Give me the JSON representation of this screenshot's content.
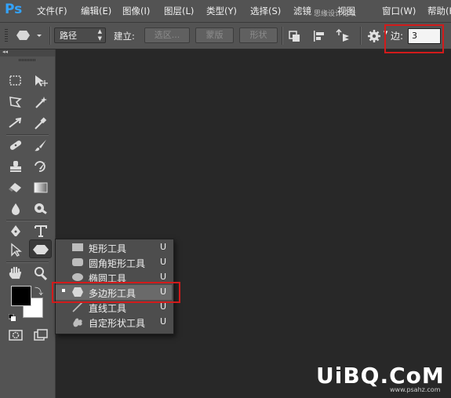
{
  "app": {
    "logo": "Ps"
  },
  "menu": [
    {
      "label": "文件(F)"
    },
    {
      "label": "编辑(E)"
    },
    {
      "label": "图像(I)"
    },
    {
      "label": "图层(L)"
    },
    {
      "label": "类型(Y)"
    },
    {
      "label": "选择(S)"
    },
    {
      "label": "滤镜"
    },
    {
      "label": "视图"
    },
    {
      "label": "窗口(W)"
    },
    {
      "label": "帮助(H"
    }
  ],
  "watermark_top": "思缘设计论坛",
  "options": {
    "mode_value": "路径",
    "make_label": "建立:",
    "selection_btn": "选区...",
    "mask_btn": "蒙版",
    "shape_btn": "形状",
    "sides_label": "边:",
    "sides_value": "3"
  },
  "flyout": [
    {
      "label": "矩形工具",
      "key": "U",
      "icon": "rectangle-shape-icon",
      "selected": false
    },
    {
      "label": "圆角矩形工具",
      "key": "U",
      "icon": "rounded-rectangle-icon",
      "selected": false
    },
    {
      "label": "椭圆工具",
      "key": "U",
      "icon": "ellipse-icon",
      "selected": false
    },
    {
      "label": "多边形工具",
      "key": "U",
      "icon": "polygon-icon",
      "selected": true
    },
    {
      "label": "直线工具",
      "key": "U",
      "icon": "line-icon",
      "selected": false
    },
    {
      "label": "自定形状工具",
      "key": "U",
      "icon": "custom-shape-icon",
      "selected": false
    }
  ],
  "watermark": {
    "brand": "UiBQ.CoM",
    "url": "www.psahz.com"
  },
  "colors": {
    "accent": "#33a3ff",
    "highlight_box": "#d21b1b",
    "panel": "#535353",
    "canvas": "#282828"
  }
}
